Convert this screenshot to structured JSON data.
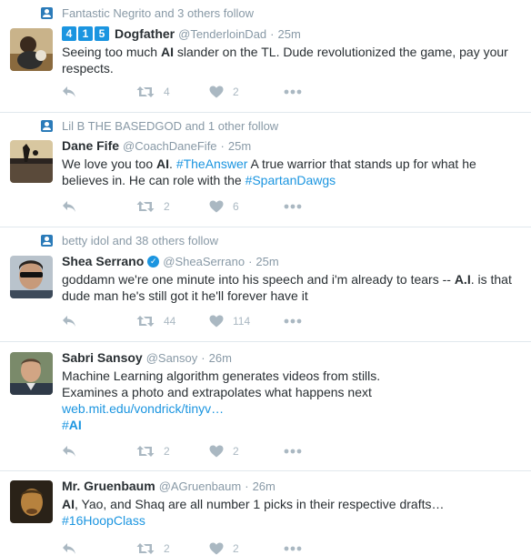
{
  "colors": {
    "link": "#1b95e0",
    "muted": "#8899a6",
    "action": "#aab8c2",
    "follow_icon": "#2b7bb9"
  },
  "tweets": [
    {
      "social": "Fantastic Negrito and 3 others follow",
      "badges": [
        "4",
        "1",
        "5"
      ],
      "name": "Dogfather",
      "handle": "@TenderloinDad",
      "sep": "·",
      "time": "25m",
      "text_parts": [
        {
          "t": "Seeing too much ",
          "s": ""
        },
        {
          "t": "AI",
          "s": "b"
        },
        {
          "t": " slander on the TL. Dude revolutionized the game, pay your respects.",
          "s": ""
        }
      ],
      "retweets": "4",
      "likes": "2"
    },
    {
      "social": "Lil B THE BASEDGOD and 1 other follow",
      "name": "Dane Fife",
      "handle": "@CoachDaneFife",
      "sep": "·",
      "time": "25m",
      "text_parts": [
        {
          "t": "We love you too ",
          "s": ""
        },
        {
          "t": "AI",
          "s": "b"
        },
        {
          "t": ". ",
          "s": ""
        },
        {
          "t": "#TheAnswer",
          "s": "link"
        },
        {
          "t": " A true warrior that stands up for what he believes in. He can role with the ",
          "s": ""
        },
        {
          "t": "#SpartanDawgs",
          "s": "link"
        }
      ],
      "retweets": "2",
      "likes": "6"
    },
    {
      "social": "betty idol and 38 others follow",
      "name": "Shea Serrano",
      "verified": true,
      "handle": "@SheaSerrano",
      "sep": "·",
      "time": "25m",
      "text_parts": [
        {
          "t": "goddamn we're one minute into his speech and i'm already to tears -- ",
          "s": ""
        },
        {
          "t": "A.I",
          "s": "b"
        },
        {
          "t": ". is that dude man he's still got it he'll forever have it",
          "s": ""
        }
      ],
      "retweets": "44",
      "likes": "114"
    },
    {
      "name": "Sabri Sansoy",
      "handle": "@Sansoy",
      "sep": "·",
      "time": "26m",
      "text_lines": [
        [
          {
            "t": "Machine Learning algorithm generates videos from stills.",
            "s": ""
          }
        ],
        [
          {
            "t": "Examines a photo and extrapolates what happens next",
            "s": ""
          }
        ],
        [
          {
            "t": "web.mit.edu/vondrick/tinyv…",
            "s": "link"
          }
        ],
        [
          {
            "t": "#",
            "s": "link"
          },
          {
            "t": "AI",
            "s": "link b"
          }
        ]
      ],
      "retweets": "2",
      "likes": "2"
    },
    {
      "name": "Mr. Gruenbaum",
      "handle": "@AGruenbaum",
      "sep": "·",
      "time": "26m",
      "text_lines": [
        [
          {
            "t": "AI",
            "s": "b"
          },
          {
            "t": ", Yao, and Shaq are all number 1 picks in their respective drafts…",
            "s": ""
          }
        ],
        [
          {
            "t": "#16HoopClass",
            "s": "link"
          }
        ]
      ],
      "retweets": "2",
      "likes": "2"
    }
  ]
}
